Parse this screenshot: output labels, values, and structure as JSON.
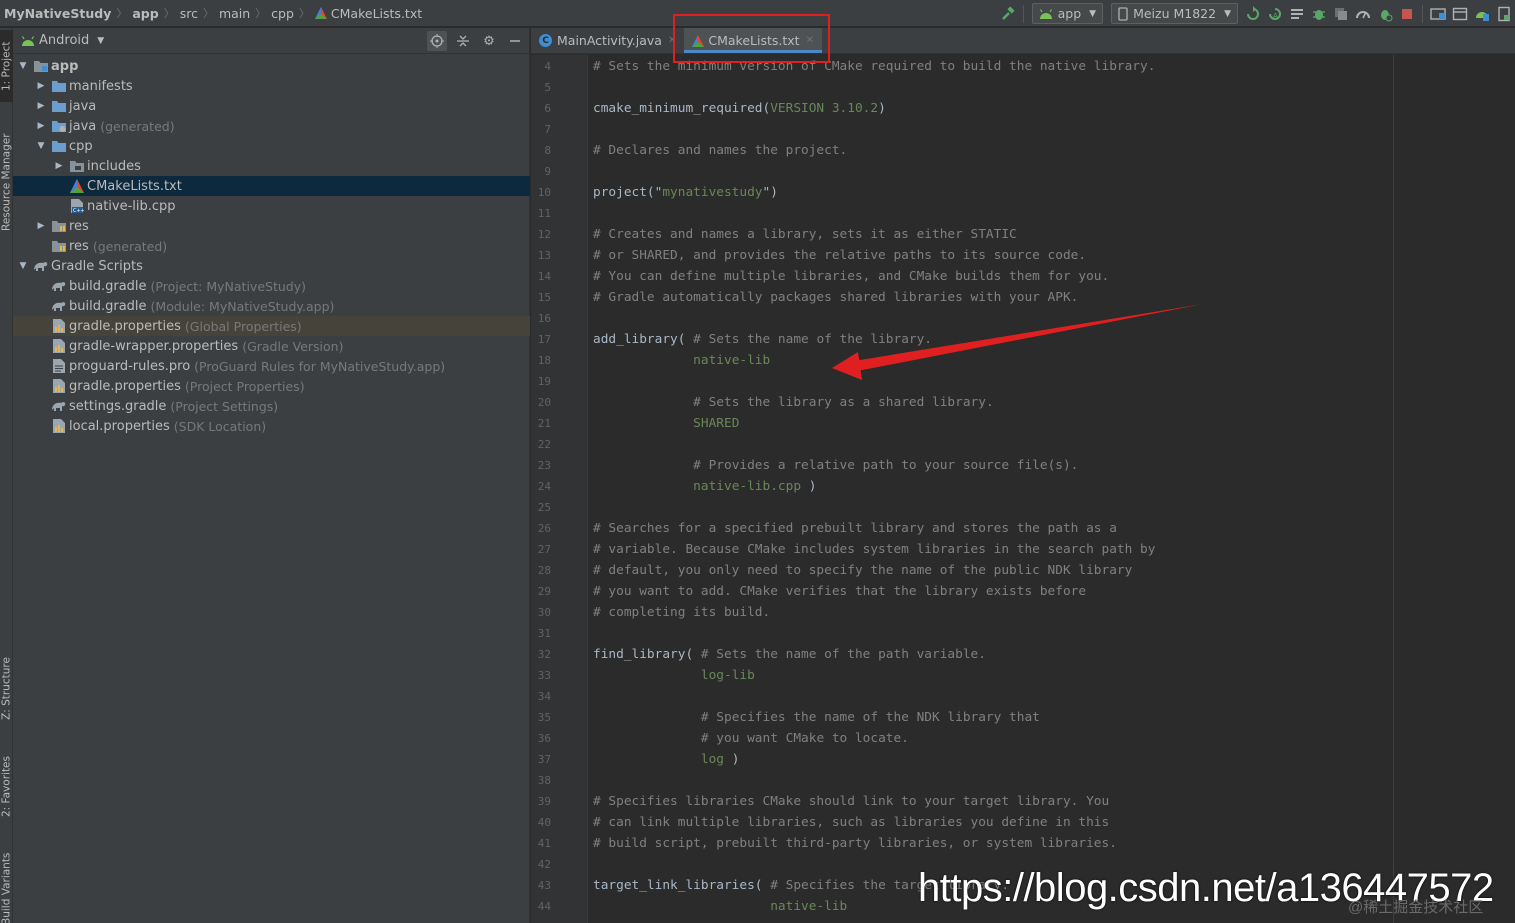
{
  "breadcrumb": {
    "items": [
      "MyNativeStudy",
      "app",
      "src",
      "main",
      "cpp",
      "CMakeLists.txt"
    ]
  },
  "toolbar": {
    "run_config": "app",
    "device": "Meizu M1822",
    "icons": [
      "hammer-icon",
      "android-icon",
      "device-icon",
      "apply-changes-icon",
      "apply-code-changes-icon",
      "sync-icon",
      "debug-icon",
      "coverage-icon",
      "profile-icon",
      "attach-debugger-icon",
      "stop-icon",
      "sdk-manager-icon",
      "layout-inspector-icon",
      "device-file-icon"
    ]
  },
  "left_strip": {
    "tabs": [
      "1: Project",
      "Resource Manager",
      "Z: Structure",
      "2: Favorites",
      "Build Variants"
    ]
  },
  "project": {
    "view_mode": "Android",
    "tree": [
      {
        "label": "app",
        "suffix": "",
        "bold": true,
        "toggle": "open"
      },
      {
        "label": "manifests",
        "suffix": "",
        "toggle": "closed"
      },
      {
        "label": "java",
        "suffix": "",
        "toggle": "closed"
      },
      {
        "label": "java",
        "suffix": "(generated)",
        "toggle": "closed"
      },
      {
        "label": "cpp",
        "suffix": "",
        "toggle": "open"
      },
      {
        "label": "includes",
        "suffix": "",
        "toggle": "closed"
      },
      {
        "label": "CMakeLists.txt",
        "suffix": "",
        "toggle": "none",
        "selected": true
      },
      {
        "label": "native-lib.cpp",
        "suffix": "",
        "toggle": "none"
      },
      {
        "label": "res",
        "suffix": "",
        "toggle": "closed"
      },
      {
        "label": "res",
        "suffix": "(generated)",
        "toggle": "none"
      },
      {
        "label": "Gradle Scripts",
        "suffix": "",
        "toggle": "open"
      },
      {
        "label": "build.gradle",
        "suffix": "(Project: MyNativeStudy)",
        "toggle": "none"
      },
      {
        "label": "build.gradle",
        "suffix": "(Module: MyNativeStudy.app)",
        "toggle": "none"
      },
      {
        "label": "gradle.properties",
        "suffix": "(Global Properties)",
        "toggle": "none",
        "highlight": true
      },
      {
        "label": "gradle-wrapper.properties",
        "suffix": "(Gradle Version)",
        "toggle": "none"
      },
      {
        "label": "proguard-rules.pro",
        "suffix": "(ProGuard Rules for MyNativeStudy.app)",
        "toggle": "none"
      },
      {
        "label": "gradle.properties",
        "suffix": "(Project Properties)",
        "toggle": "none"
      },
      {
        "label": "settings.gradle",
        "suffix": "(Project Settings)",
        "toggle": "none"
      },
      {
        "label": "local.properties",
        "suffix": "(SDK Location)",
        "toggle": "none"
      }
    ]
  },
  "editor": {
    "tabs": [
      {
        "label": "MainActivity.java",
        "active": false
      },
      {
        "label": "CMakeLists.txt",
        "active": true
      }
    ],
    "lines": [
      {
        "n": "4",
        "parts": [
          [
            "c",
            "# Sets the minimum version of CMake required to build the native library."
          ]
        ]
      },
      {
        "n": "5",
        "parts": []
      },
      {
        "n": "6",
        "parts": [
          [
            "p",
            "cmake_minimum_required("
          ],
          [
            "g",
            "VERSION 3.10.2"
          ],
          [
            "p",
            ")"
          ]
        ]
      },
      {
        "n": "7",
        "parts": []
      },
      {
        "n": "8",
        "parts": [
          [
            "c",
            "# Declares and names the project."
          ]
        ]
      },
      {
        "n": "9",
        "parts": []
      },
      {
        "n": "10",
        "parts": [
          [
            "p",
            "project(\""
          ],
          [
            "g",
            "mynativestudy"
          ],
          [
            "p",
            "\")"
          ]
        ]
      },
      {
        "n": "11",
        "parts": []
      },
      {
        "n": "12",
        "parts": [
          [
            "c",
            "# Creates and names a library, sets it as either STATIC"
          ]
        ]
      },
      {
        "n": "13",
        "parts": [
          [
            "c",
            "# or SHARED, and provides the relative paths to its source code."
          ]
        ]
      },
      {
        "n": "14",
        "parts": [
          [
            "c",
            "# You can define multiple libraries, and CMake builds them for you."
          ]
        ]
      },
      {
        "n": "15",
        "parts": [
          [
            "c",
            "# Gradle automatically packages shared libraries with your APK."
          ]
        ]
      },
      {
        "n": "16",
        "parts": []
      },
      {
        "n": "17",
        "parts": [
          [
            "p",
            "add_library( "
          ],
          [
            "c",
            "# Sets the name of the library."
          ]
        ]
      },
      {
        "n": "18",
        "parts": [
          [
            "p",
            "             "
          ],
          [
            "g",
            "native-lib"
          ]
        ]
      },
      {
        "n": "19",
        "parts": []
      },
      {
        "n": "20",
        "parts": [
          [
            "p",
            "             "
          ],
          [
            "c",
            "# Sets the library as a shared library."
          ]
        ]
      },
      {
        "n": "21",
        "parts": [
          [
            "p",
            "             "
          ],
          [
            "g",
            "SHARED"
          ]
        ]
      },
      {
        "n": "22",
        "parts": []
      },
      {
        "n": "23",
        "parts": [
          [
            "p",
            "             "
          ],
          [
            "c",
            "# Provides a relative path to your source file(s)."
          ]
        ]
      },
      {
        "n": "24",
        "parts": [
          [
            "p",
            "             "
          ],
          [
            "g",
            "native-lib.cpp"
          ],
          [
            "p",
            " )"
          ]
        ]
      },
      {
        "n": "25",
        "parts": []
      },
      {
        "n": "26",
        "parts": [
          [
            "c",
            "# Searches for a specified prebuilt library and stores the path as a"
          ]
        ]
      },
      {
        "n": "27",
        "parts": [
          [
            "c",
            "# variable. Because CMake includes system libraries in the search path by"
          ]
        ]
      },
      {
        "n": "28",
        "parts": [
          [
            "c",
            "# default, you only need to specify the name of the public NDK library"
          ]
        ]
      },
      {
        "n": "29",
        "parts": [
          [
            "c",
            "# you want to add. CMake verifies that the library exists before"
          ]
        ]
      },
      {
        "n": "30",
        "parts": [
          [
            "c",
            "# completing its build."
          ]
        ]
      },
      {
        "n": "31",
        "parts": []
      },
      {
        "n": "32",
        "parts": [
          [
            "p",
            "find_library( "
          ],
          [
            "c",
            "# Sets the name of the path variable."
          ]
        ]
      },
      {
        "n": "33",
        "parts": [
          [
            "p",
            "              "
          ],
          [
            "g",
            "log-lib"
          ]
        ]
      },
      {
        "n": "34",
        "parts": []
      },
      {
        "n": "35",
        "parts": [
          [
            "p",
            "              "
          ],
          [
            "c",
            "# Specifies the name of the NDK library that"
          ]
        ]
      },
      {
        "n": "36",
        "parts": [
          [
            "p",
            "              "
          ],
          [
            "c",
            "# you want CMake to locate."
          ]
        ]
      },
      {
        "n": "37",
        "parts": [
          [
            "p",
            "              "
          ],
          [
            "g",
            "log"
          ],
          [
            "p",
            " )"
          ]
        ]
      },
      {
        "n": "38",
        "parts": []
      },
      {
        "n": "39",
        "parts": [
          [
            "c",
            "# Specifies libraries CMake should link to your target library. You"
          ]
        ]
      },
      {
        "n": "40",
        "parts": [
          [
            "c",
            "# can link multiple libraries, such as libraries you define in this"
          ]
        ]
      },
      {
        "n": "41",
        "parts": [
          [
            "c",
            "# build script, prebuilt third-party libraries, or system libraries."
          ]
        ]
      },
      {
        "n": "42",
        "parts": []
      },
      {
        "n": "43",
        "parts": [
          [
            "p",
            "target_link_libraries( "
          ],
          [
            "c",
            "# Specifies the target library."
          ]
        ]
      },
      {
        "n": "44",
        "parts": [
          [
            "p",
            "                       "
          ],
          [
            "g",
            "native-lib"
          ]
        ]
      }
    ]
  },
  "watermark": {
    "url": "https://blog.csdn.net/a136447572",
    "credit": "@稀土掘金技术社区"
  },
  "colors": {
    "annotation_red": "#e02020",
    "comment": "#808080",
    "string": "#6a8759",
    "plain": "#a9b7c6",
    "selection": "#0d293e",
    "tab_underline": "#4a88c7"
  }
}
